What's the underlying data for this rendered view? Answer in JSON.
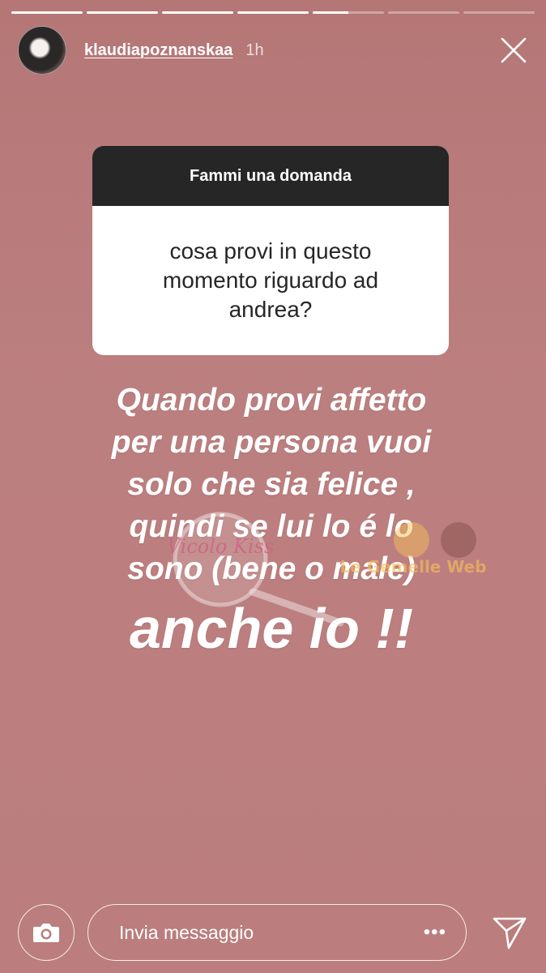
{
  "story": {
    "segments": [
      1,
      1,
      1,
      1,
      0.5,
      0,
      0
    ],
    "username": "klaudiapoznanskaa",
    "time": "1h"
  },
  "question_sticker": {
    "title": "Fammi una domanda",
    "question": "cosa provi in questo momento riguardo ad andrea?"
  },
  "answer": {
    "lines": [
      "Quando provi affetto",
      "per una persona vuoi",
      "solo che sia felice ,",
      "quindi se lui lo é lo",
      "sono (bene o male)"
    ],
    "final": "anche io !!"
  },
  "watermark": {
    "text_left": "Vicolo Kiss",
    "text_right": "Le Gemelle Web"
  },
  "reply": {
    "placeholder": "Invia messaggio",
    "more_label": "•••"
  },
  "icons": {
    "close": "close-icon",
    "camera": "camera-icon",
    "send": "send-icon"
  }
}
